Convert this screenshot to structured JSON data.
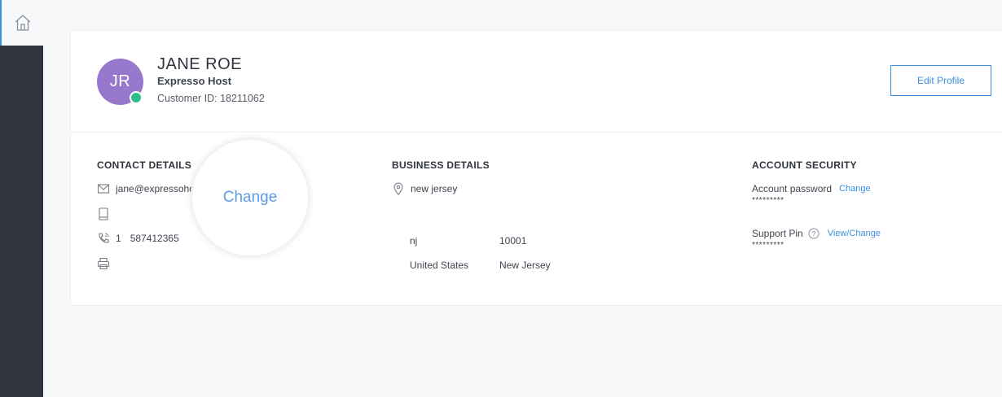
{
  "profile": {
    "initials": "JR",
    "name": "JANE ROE",
    "company": "Expresso Host",
    "customer_id": "Customer ID: 18211062",
    "edit_label": "Edit Profile"
  },
  "contact": {
    "title": "CONTACT DETAILS",
    "email": "jane@expressohost.com",
    "phone_code": "1",
    "phone_number": "587412365"
  },
  "magnifier_label": "Change",
  "business": {
    "title": "BUSINESS DETAILS",
    "location": "new jersey",
    "state_code": "nj",
    "zip": "10001",
    "country": "United States",
    "state": "New Jersey"
  },
  "security": {
    "title": "ACCOUNT SECURITY",
    "password_label": "Account password",
    "password_change": "Change",
    "password_mask": "*********",
    "pin_label": "Support Pin",
    "pin_action": "View/Change",
    "pin_mask": "*********"
  },
  "colors": {
    "accent": "#3b8ee0",
    "avatar": "#9778cc",
    "online": "#2fbf8a",
    "sidebar": "#30343f"
  }
}
